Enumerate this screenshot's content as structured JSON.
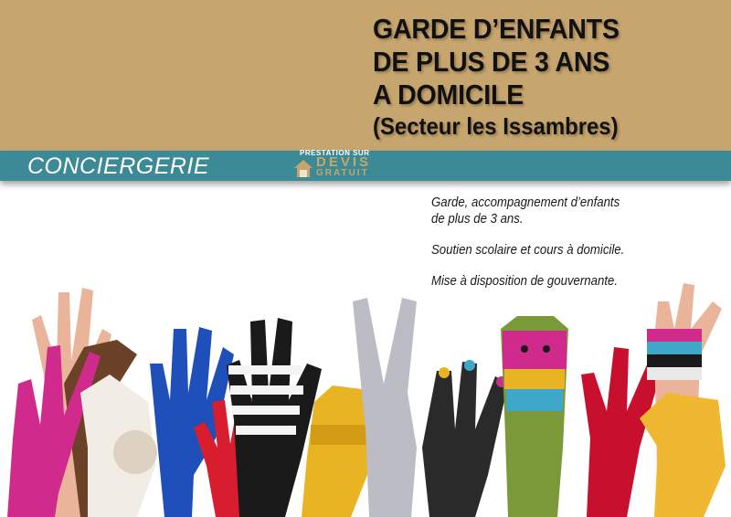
{
  "header": {
    "title_lines": [
      "GARDE D’ENFANTS",
      "DE PLUS DE 3 ANS",
      "A DOMICILE"
    ],
    "subtitle": "(Secteur les Issambres)",
    "band_color": "#c7a56e"
  },
  "banner": {
    "label": "CONCIERGERIE",
    "bar_color": "#3c8a96",
    "logo": {
      "top_text": "PRESTATION SUR",
      "main_text": "DEVIS",
      "sub_text": "GRATUIT",
      "icon": "house-icon"
    }
  },
  "services": {
    "item1_line1": "Garde, accompagnement d’enfants",
    "item1_line2": "de plus de 3 ans.",
    "item2": "Soutien scolaire et cours à domicile.",
    "item3": "Mise à disposition de gouvernante."
  },
  "image": {
    "subject": "gloved-hands-illustration",
    "glove_colors": [
      "#d02a8c",
      "#f2ede4",
      "#1f4fb8",
      "#d81e2e",
      "#1a1a1a",
      "#e8b423",
      "#bcbcc4",
      "#2a2a2a",
      "#7a9a3a",
      "#c8102e",
      "#f0b830",
      "#3fa8c8"
    ]
  }
}
